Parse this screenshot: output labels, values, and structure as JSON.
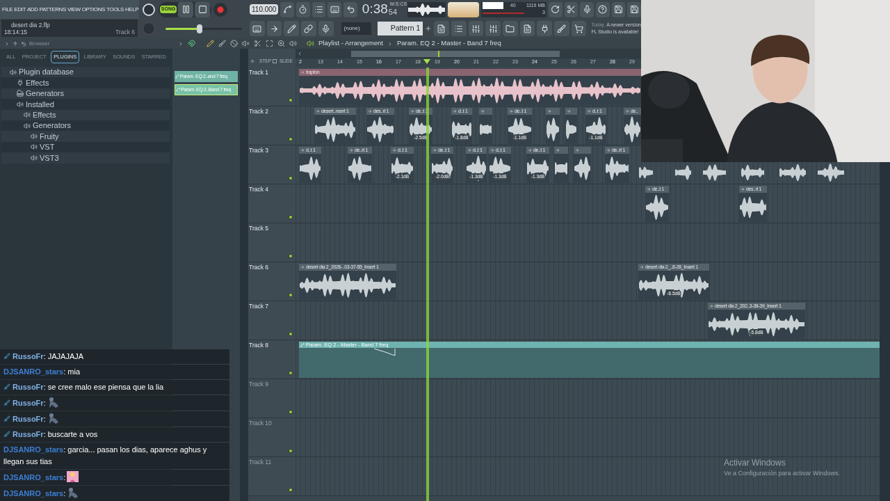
{
  "menu": [
    "FILE",
    "EDIT",
    "ADD",
    "PATTERNS",
    "VIEW",
    "OPTIONS",
    "TOOLS",
    "HELP"
  ],
  "project": {
    "file": "desert dia 2.flp",
    "time": "18:14:15",
    "track": "Track 6"
  },
  "transport": {
    "song_mode": true,
    "mode_label": "SONG",
    "tempo": "110.000",
    "clock": "0:38",
    "clock_cs": "54",
    "clock_unit": "M:S:CS"
  },
  "master_volume": {
    "level": 0.45
  },
  "cpu": {
    "value": "40",
    "memory": "1119 MB",
    "polyphony": "3"
  },
  "pattern": {
    "channel": "(none)",
    "name": "Pattern 1"
  },
  "news": {
    "when": "Today",
    "line1": "A newer version",
    "line2": "FL Studio is available!"
  },
  "browser": {
    "title": "Browser",
    "tabs": [
      {
        "label": "ALL",
        "selected": false
      },
      {
        "label": "PROJECT",
        "selected": false
      },
      {
        "label": "PLUGINS",
        "selected": true
      },
      {
        "label": "LIBRARY",
        "selected": false
      },
      {
        "label": "SOUNDS",
        "selected": false
      },
      {
        "label": "STARRED",
        "selected": false
      }
    ],
    "tree": [
      {
        "label": "Plugin database",
        "kind": "speaker",
        "children": [
          {
            "label": "Effects",
            "kind": "plug"
          },
          {
            "label": "Generators",
            "kind": "keys"
          },
          {
            "label": "Installed",
            "kind": "speaker",
            "children": [
              {
                "label": "Effects",
                "kind": "speaker"
              },
              {
                "label": "Generators",
                "kind": "speaker",
                "children": [
                  {
                    "label": "Fruity",
                    "kind": "speaker"
                  },
                  {
                    "label": "VST",
                    "kind": "speaker"
                  },
                  {
                    "label": "VST3",
                    "kind": "speaker"
                  }
                ]
              }
            ]
          }
        ]
      }
    ]
  },
  "clip_list": [
    {
      "label": "Param. EQ 2..and 7 freq",
      "selected": false
    },
    {
      "label": "Param. EQ 2..Band 7 freq",
      "selected": true
    }
  ],
  "playlist": {
    "title": "Playlist - Arrangement",
    "breadcrumb": "Param. EQ 2 - Master - Band 7 freq",
    "step_label": "STEP",
    "step_on": false,
    "slide_label": "SLIDE",
    "ruler": [
      "2",
      "13",
      "14",
      "15",
      "16",
      "17",
      "18",
      "19",
      "20",
      "21",
      "22",
      "23",
      "24",
      "25",
      "26",
      "27",
      "28",
      "29"
    ],
    "tracks": [
      {
        "name": "Track 1",
        "dimmed": false,
        "clips": [
          {
            "kind": "audio",
            "label": "trapton",
            "color": "#e8c2ca"
          }
        ]
      },
      {
        "name": "Track 2",
        "dimmed": false,
        "clips": [
          {
            "kind": "audio",
            "label": "desert..nsert 1",
            "color": "#c9d0d4"
          },
          {
            "kind": "audio",
            "label": "des..rt 1",
            "color": "#c9d0d4"
          },
          {
            "kind": "audio",
            "label": "de..t 1",
            "gain": "-2.5dB",
            "color": "#c9d0d4"
          },
          {
            "kind": "audio",
            "label": "d..t 1",
            "gain": "-1.8dB",
            "color": "#c9d0d4"
          },
          {
            "kind": "audio",
            "color": "#c9d0d4"
          },
          {
            "kind": "audio",
            "label": "de..t 1",
            "gain": "-1.1dB",
            "color": "#c9d0d4"
          },
          {
            "kind": "audio",
            "color": "#c9d0d4"
          },
          {
            "kind": "audio",
            "color": "#c9d0d4"
          },
          {
            "kind": "audio",
            "label": "d..t 1",
            "gain": "-1.1dB",
            "color": "#c9d0d4"
          },
          {
            "kind": "audio",
            "label": "de..",
            "color": "#c9d0d4"
          }
        ]
      },
      {
        "name": "Track 3",
        "dimmed": false,
        "clips": [
          {
            "kind": "audio",
            "label": "d..t 1",
            "color": "#c9d0d4"
          },
          {
            "kind": "audio",
            "label": "de..rt 1",
            "color": "#c9d0d4"
          },
          {
            "kind": "audio",
            "label": "d..t 1",
            "gain": "-2.1dB",
            "color": "#c9d0d4"
          },
          {
            "kind": "audio",
            "label": "de..t 1",
            "gain": "-2.0dB",
            "color": "#c9d0d4"
          },
          {
            "kind": "audio",
            "label": "d..t 1",
            "gain": "-1.3dB",
            "color": "#c9d0d4"
          },
          {
            "kind": "audio",
            "label": "d..t 1",
            "gain": "-1.3dB",
            "color": "#c9d0d4"
          },
          {
            "kind": "audio",
            "label": "de..t 1",
            "gain": "-1.3dB",
            "color": "#c9d0d4"
          },
          {
            "kind": "audio",
            "color": "#c9d0d4"
          },
          {
            "kind": "audio",
            "color": "#c9d0d4"
          },
          {
            "kind": "audio",
            "label": "de..rt 1",
            "color": "#c9d0d4"
          },
          {
            "kind": "audio",
            "color": "#c9d0d4"
          },
          {
            "kind": "audio",
            "color": "#c9d0d4"
          },
          {
            "kind": "audio",
            "color": "#c9d0d4"
          },
          {
            "kind": "audio",
            "color": "#c9d0d4"
          },
          {
            "kind": "audio",
            "color": "#c9d0d4"
          },
          {
            "kind": "audio",
            "color": "#c9d0d4"
          }
        ]
      },
      {
        "name": "Track 4",
        "dimmed": false,
        "clips": [
          {
            "kind": "audio",
            "label": "de..t 1",
            "color": "#c9d0d4"
          },
          {
            "kind": "audio",
            "label": "des..rt 1",
            "color": "#c9d0d4"
          }
        ]
      },
      {
        "name": "Track 5",
        "dimmed": false
      },
      {
        "name": "Track 6",
        "dimmed": false,
        "clips": [
          {
            "kind": "audio",
            "label": "desert dia 2_2026-..03-37-55_Insert 1",
            "color": "#c9d0d4"
          },
          {
            "kind": "audio",
            "label": "desert dia 2_..8-26_Insert 1",
            "gain": "-6.5dB",
            "color": "#c9d0d4"
          }
        ]
      },
      {
        "name": "Track 7",
        "dimmed": false,
        "clips": [
          {
            "kind": "audio",
            "label": "desert dia 2_202..3-38-39_Insert 1",
            "gain": "-5.8dB",
            "color": "#c9d0d4"
          }
        ]
      },
      {
        "name": "Track 8",
        "dimmed": false,
        "clips": [
          {
            "kind": "automation",
            "label": "Param. EQ 2 - Master - Band 7 freq",
            "color": "#6fb3b0"
          }
        ]
      },
      {
        "name": "Track 9",
        "dimmed": true
      },
      {
        "name": "Track 10",
        "dimmed": true
      },
      {
        "name": "Track 11",
        "dimmed": true
      }
    ]
  },
  "chat": [
    {
      "user": "RussoFr",
      "badge": true,
      "kind": "text",
      "text": ": JAJAJAJA"
    },
    {
      "user": "DJSANRO_stars",
      "badge": false,
      "kind": "text",
      "text": ": mia"
    },
    {
      "user": "RussoFr",
      "badge": true,
      "kind": "text",
      "text": ": se cree malo ese piensa que la lia"
    },
    {
      "user": "RussoFr",
      "badge": true,
      "kind": "crouch",
      "text": ":"
    },
    {
      "user": "RussoFr",
      "badge": true,
      "kind": "crouch",
      "text": ":"
    },
    {
      "user": "RussoFr",
      "badge": true,
      "kind": "text",
      "text": ": buscarte a vos"
    },
    {
      "user": "DJSANRO_stars",
      "badge": false,
      "kind": "text",
      "text": ": garcia... pasan los dias, aparece aghus y llegan sus tias"
    },
    {
      "user": "DJSANRO_stars",
      "badge": false,
      "kind": "pink",
      "text": ":"
    },
    {
      "user": "DJSANRO_stars",
      "badge": false,
      "kind": "crouch",
      "text": ":"
    }
  ],
  "activation": {
    "title": "Activar Windows",
    "text": "Ve a Configuración para activar Windows."
  }
}
